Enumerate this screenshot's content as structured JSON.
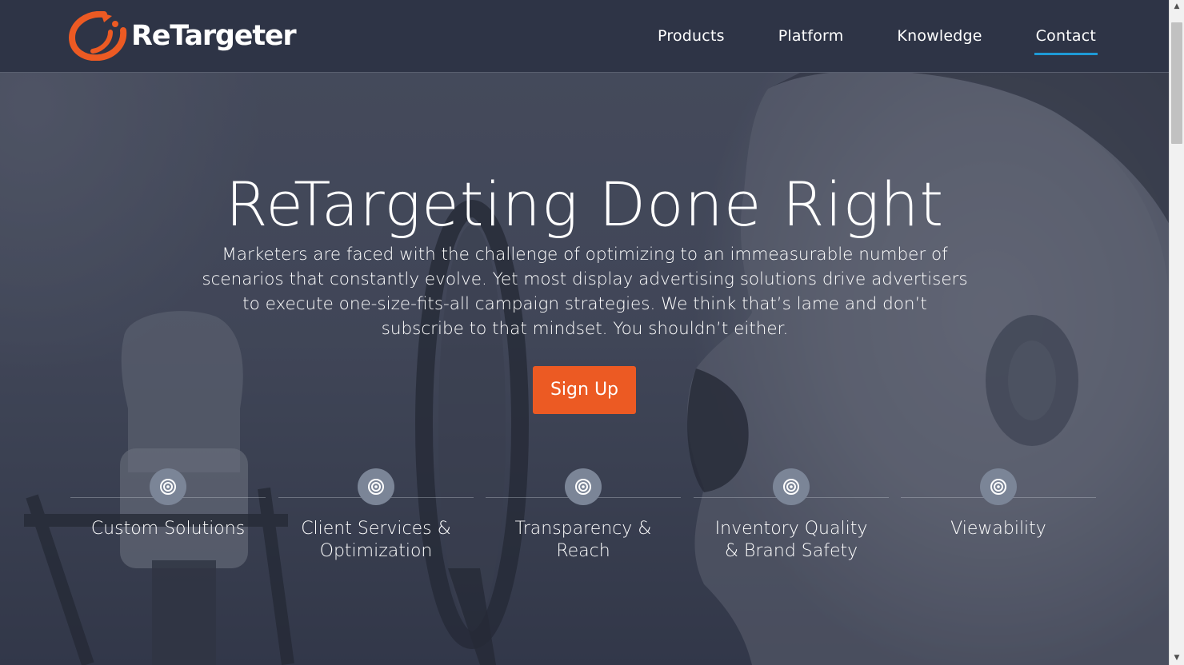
{
  "brand": {
    "name": "ReTargeter",
    "accent": "#ec5a23",
    "highlight": "#1e9ad6",
    "header_bg": "#2e3446"
  },
  "nav": {
    "items": [
      {
        "label": "Products",
        "active": false
      },
      {
        "label": "Platform",
        "active": false
      },
      {
        "label": "Knowledge",
        "active": false
      },
      {
        "label": "Contact",
        "active": true
      }
    ]
  },
  "hero": {
    "title": "ReTargeting Done Right",
    "description": "Marketers are faced with the challenge of optimizing to an immeasurable number of scenarios that constantly evolve. Yet most display advertising solutions drive advertisers to execute one-size-fits-all campaign strategies. We think that’s lame and don’t subscribe to that mindset. You shouldn’t either.",
    "cta_label": "Sign Up"
  },
  "features": [
    {
      "line1": "Custom Solutions",
      "line2": "",
      "icon": "target-icon"
    },
    {
      "line1": "Client Services &",
      "line2": "Optimization",
      "icon": "target-icon"
    },
    {
      "line1": "Transparency &",
      "line2": "Reach",
      "icon": "target-icon"
    },
    {
      "line1": "Inventory Quality",
      "line2": "& Brand Safety",
      "icon": "target-icon"
    },
    {
      "line1": "Viewability",
      "line2": "",
      "icon": "target-icon"
    }
  ]
}
